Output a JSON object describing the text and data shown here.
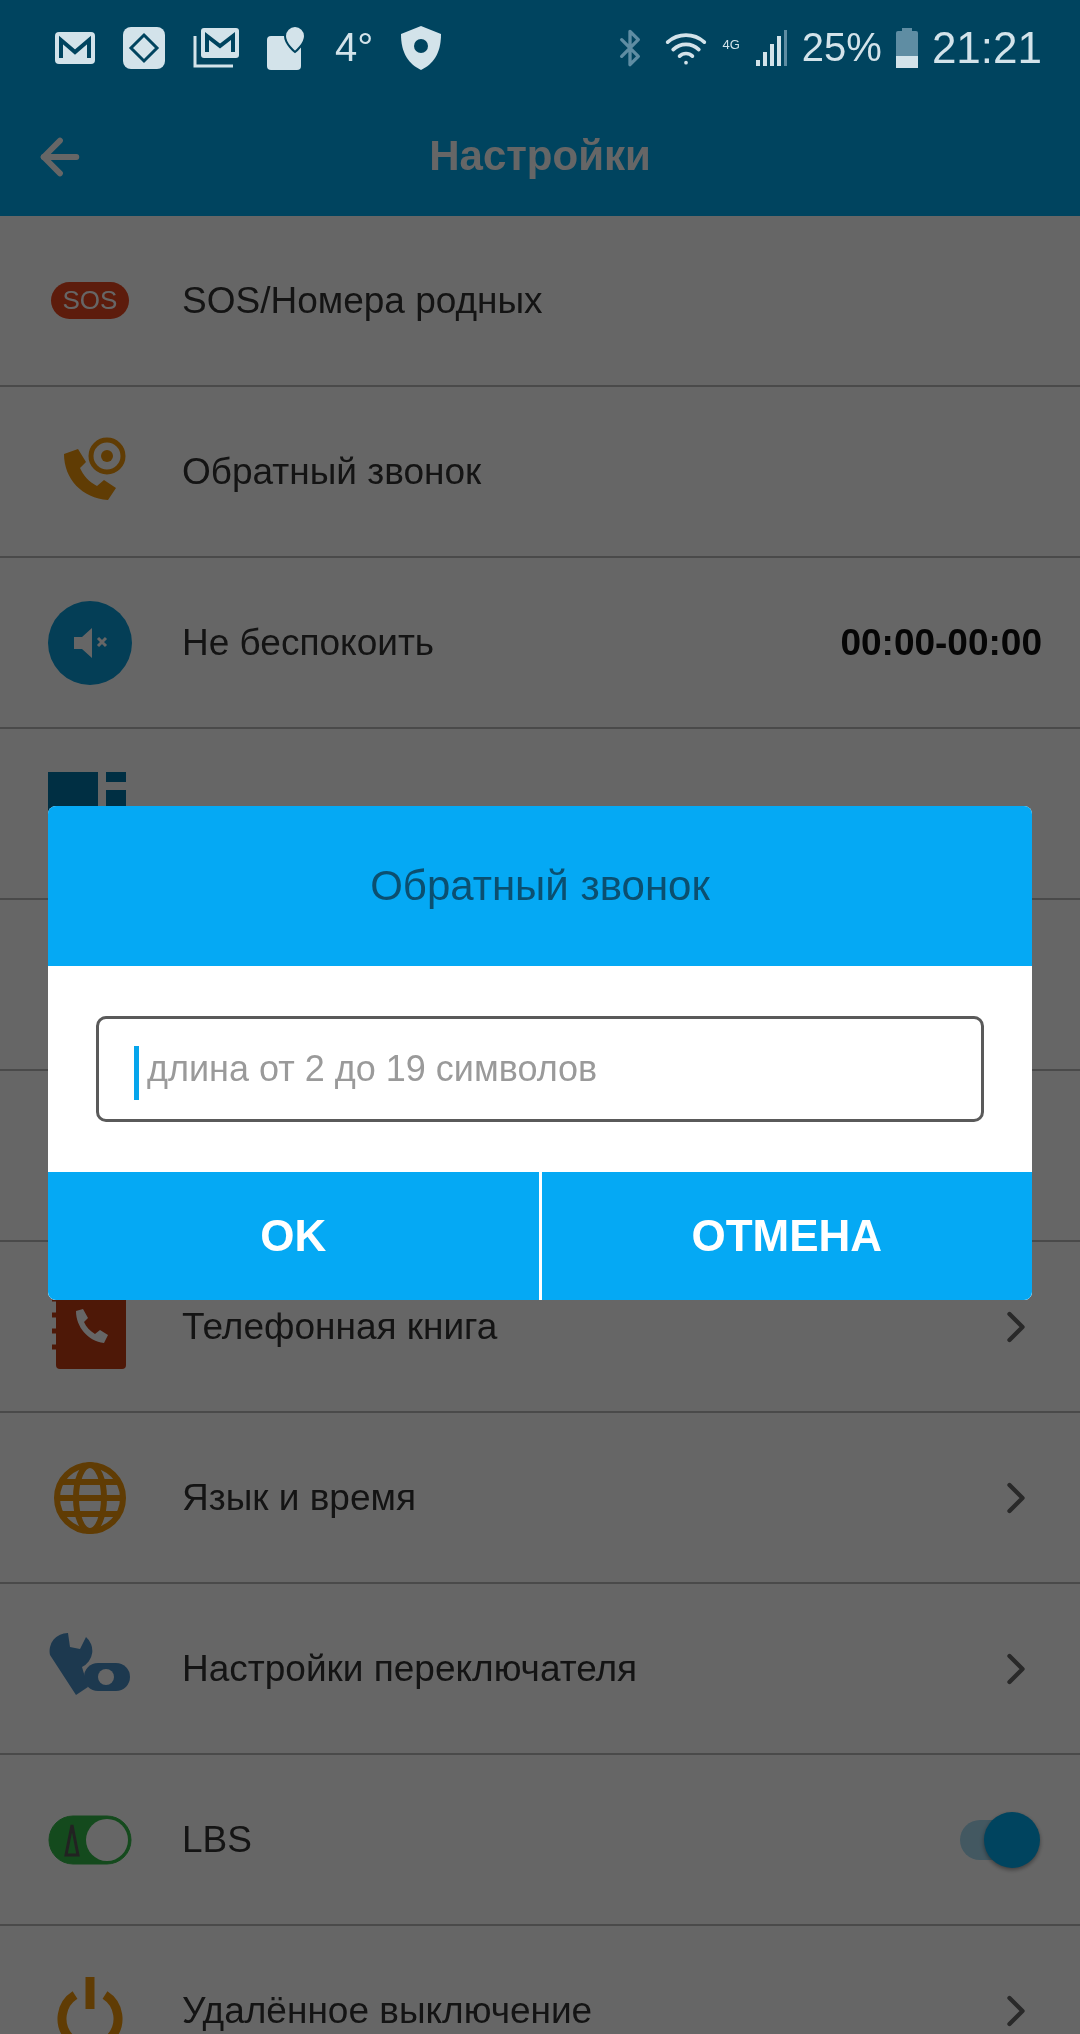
{
  "status_bar": {
    "temperature": "4°",
    "network": "4G",
    "battery": "25%",
    "time": "21:21"
  },
  "app_bar": {
    "title": "Настройки"
  },
  "rows": [
    {
      "kind": "plain",
      "badge": "SOS",
      "label": "SOS/Номера родных"
    },
    {
      "kind": "plain",
      "label": "Обратный звонок"
    },
    {
      "kind": "value",
      "label": "Не беспокоить",
      "value": "00:00-00:00"
    },
    {
      "kind": "covered"
    },
    {
      "kind": "covered"
    },
    {
      "kind": "covered"
    },
    {
      "kind": "nav",
      "label": "Телефонная книга"
    },
    {
      "kind": "nav",
      "label": "Язык и время"
    },
    {
      "kind": "nav",
      "label": "Настройки переключателя"
    },
    {
      "kind": "toggle",
      "label": "LBS",
      "on": true
    },
    {
      "kind": "nav",
      "label": "Удалённое выключение"
    }
  ],
  "dialog": {
    "title": "Обратный звонок",
    "field": {
      "placeholder": "длина от 2 до 19 символов"
    },
    "buttons": [
      "OK",
      "ОТМЕНА"
    ]
  }
}
